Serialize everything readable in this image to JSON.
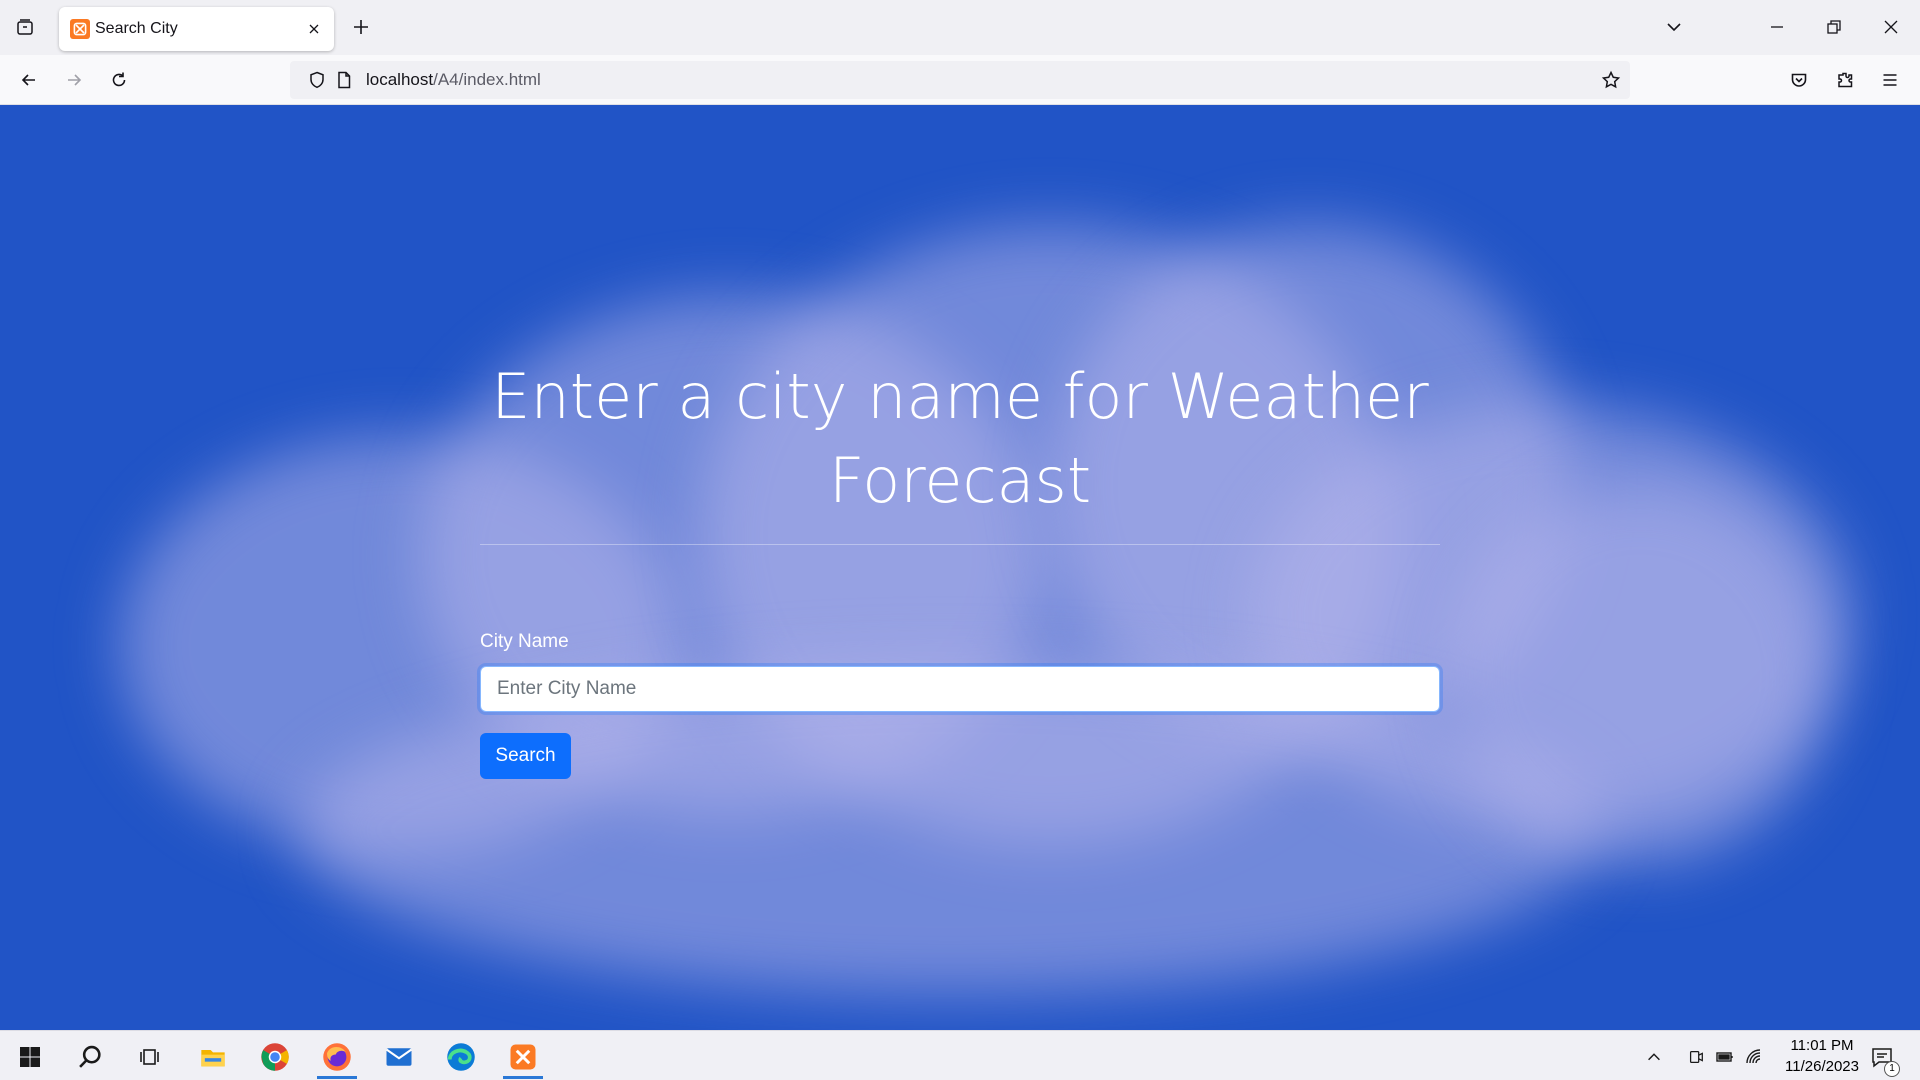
{
  "browser": {
    "tab_title": "Search City",
    "url_host": "localhost",
    "url_path": "/A4/index.html"
  },
  "page": {
    "heading": "Enter a city name for Weather Forecast",
    "city_label": "City Name",
    "city_placeholder": "Enter City Name",
    "city_value": "",
    "search_label": "Search"
  },
  "taskbar": {
    "time": "11:01 PM",
    "date": "11/26/2023",
    "notification_count": "1",
    "apps": [
      "start-icon",
      "search-icon",
      "task-view-icon",
      "file-explorer-icon",
      "chrome-icon",
      "firefox-icon",
      "mail-icon",
      "edge-icon",
      "xampp-icon"
    ]
  },
  "colors": {
    "sky": "#2154c6",
    "button": "#0d6efd",
    "favicon": "#fb7a24"
  }
}
